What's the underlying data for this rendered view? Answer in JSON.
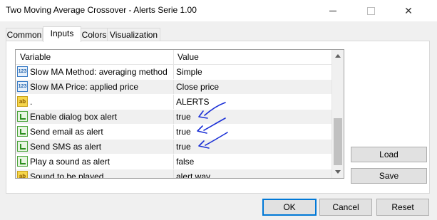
{
  "window": {
    "title": "Two Moving Average Crossover - Alerts Serie 1.00",
    "minimize_glyph": "—",
    "maximize_glyph": "☐",
    "close_glyph": "✕"
  },
  "tabs": [
    {
      "label": "Common",
      "active": false
    },
    {
      "label": "Inputs",
      "active": true
    },
    {
      "label": "Colors",
      "active": false
    },
    {
      "label": "Visualization",
      "active": false
    }
  ],
  "grid": {
    "columns": [
      "Variable",
      "Value"
    ],
    "rows": [
      {
        "icon": "numeric-123-icon",
        "icon_text": "123",
        "variable": "Slow MA Method: averaging method",
        "value": "Simple"
      },
      {
        "icon": "numeric-123-icon",
        "icon_text": "123",
        "variable": "Slow MA Price: applied price",
        "value": "Close price"
      },
      {
        "icon": "string-ab-icon",
        "icon_text": "ab",
        "variable": ".",
        "value": "ALERTS"
      },
      {
        "icon": "boolean-icon",
        "icon_text": "",
        "variable": "Enable dialog box alert",
        "value": "true"
      },
      {
        "icon": "boolean-icon",
        "icon_text": "",
        "variable": "Send email as alert",
        "value": "true"
      },
      {
        "icon": "boolean-icon",
        "icon_text": "",
        "variable": "Send SMS as alert",
        "value": "true"
      },
      {
        "icon": "boolean-icon",
        "icon_text": "",
        "variable": "Play a sound as alert",
        "value": "false"
      },
      {
        "icon": "string-ab-icon",
        "icon_text": "ab",
        "variable": "Sound to be played",
        "value": "alert.wav"
      }
    ]
  },
  "side_buttons": {
    "load": "Load",
    "save": "Save"
  },
  "footer": {
    "ok": "OK",
    "cancel": "Cancel",
    "reset": "Reset"
  },
  "colors": {
    "accent": "#0078d7",
    "annotation": "#1a2fd6",
    "alt_row": "#f0f0f0"
  }
}
